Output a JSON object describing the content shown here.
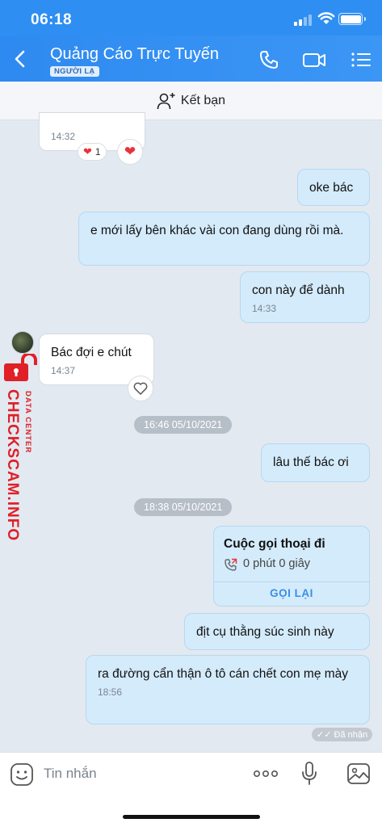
{
  "status_bar": {
    "time": "06:18"
  },
  "header": {
    "title": "Quảng Cáo Trực Tuyến",
    "tag": "NGƯỜI LẠ"
  },
  "add_friend": {
    "label": "Kết bạn"
  },
  "messages": [
    {
      "side": "in",
      "text": "",
      "time": "14:32"
    },
    {
      "side": "out",
      "text": "oke bác"
    },
    {
      "side": "out",
      "text": "e mới lấy bên khác vài con đang dùng rồi mà."
    },
    {
      "side": "out",
      "text": "con này để dành",
      "time": "14:33"
    },
    {
      "side": "in",
      "text": "Bác đợi e chút",
      "time": "14:37"
    },
    {
      "side": "out",
      "text": "lâu thế bác ơi"
    },
    {
      "side": "out",
      "text": "địt cụ thằng súc sinh này"
    },
    {
      "side": "out",
      "text": "ra đường cẩn thận ô tô cán chết con mẹ mày",
      "time": "18:56"
    }
  ],
  "reactions": {
    "heart_count": "1"
  },
  "date_separators": [
    "16:46 05/10/2021",
    "18:38 05/10/2021"
  ],
  "call": {
    "title": "Cuộc gọi thoại đi",
    "duration": "0 phút 0 giây",
    "callback": "GỌI LẠI"
  },
  "seen": "Đã nhận",
  "watermark": {
    "brand": "CHECKSCAM.INFO",
    "sub": "DATA CENTER"
  },
  "input": {
    "placeholder": "Tin nhắn"
  },
  "colors": {
    "header": "#2f8ef2",
    "outgoing_bubble": "#d4ebfb",
    "incoming_bubble": "#ffffff",
    "background": "#e2e9f1",
    "heart": "#e8333b",
    "watermark": "#e01f27"
  }
}
